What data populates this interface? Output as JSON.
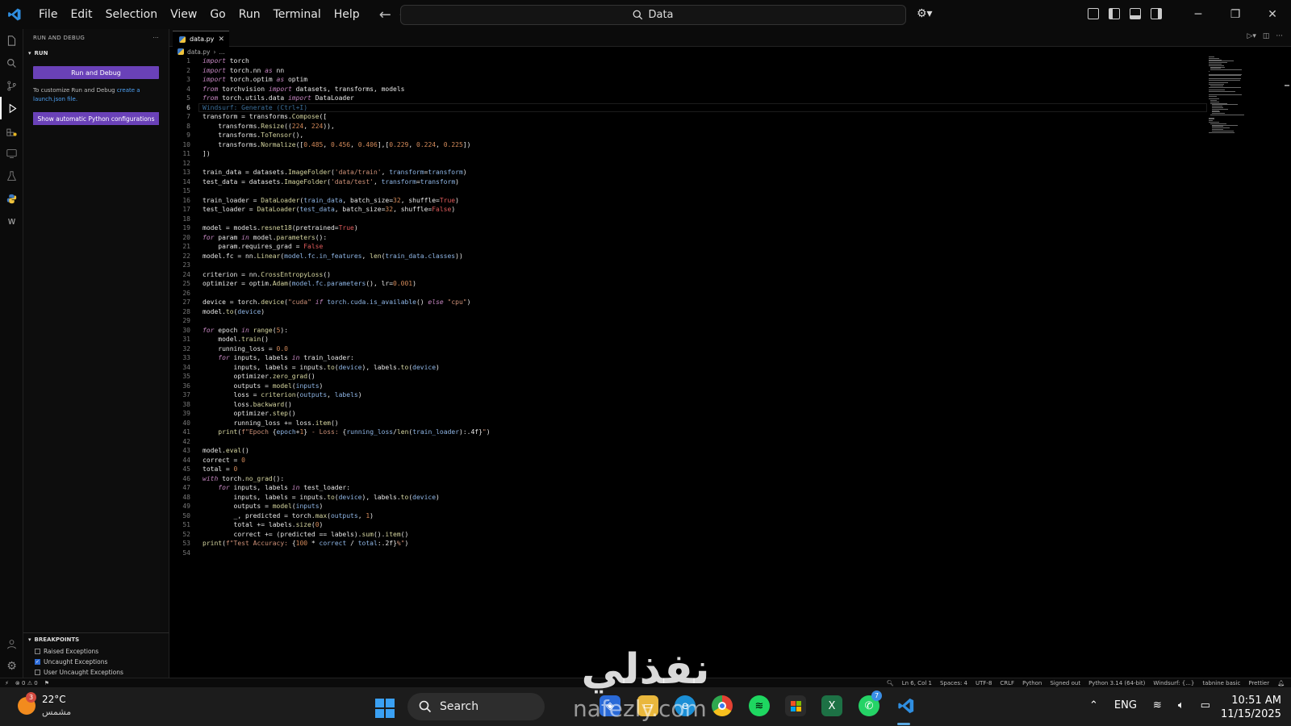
{
  "titlebar": {
    "menu": [
      "File",
      "Edit",
      "Selection",
      "View",
      "Go",
      "Run",
      "Terminal",
      "Help"
    ],
    "search_text": "Data"
  },
  "sidebar": {
    "title": "RUN AND DEBUG",
    "section": "RUN",
    "run_button": "Run and Debug",
    "customize_text": "To customize Run and Debug",
    "customize_link": "create a launch.json file.",
    "show_config_button": "Show automatic Python configurations",
    "breakpoints_title": "BREAKPOINTS",
    "breakpoints": [
      {
        "label": "Raised Exceptions",
        "checked": false
      },
      {
        "label": "Uncaught Exceptions",
        "checked": true
      },
      {
        "label": "User Uncaught Exceptions",
        "checked": false
      }
    ]
  },
  "editor": {
    "tab_name": "data.py",
    "breadcrumb_file": "data.py",
    "breadcrumb_rest": "...",
    "current_line": 6,
    "lines": [
      "<span class='kw'>import</span> torch",
      "<span class='kw'>import</span> torch.nn <span class='kw'>as</span> nn",
      "<span class='kw'>import</span> torch.optim <span class='kw'>as</span> optim",
      "<span class='kw'>from</span> torchvision <span class='kw'>import</span> datasets, transforms, models",
      "<span class='kw'>from</span> torch.utils.data <span class='kw'>import</span> DataLoader",
      "<span class='hint'>Windsurf: Generate (Ctrl+I)</span>",
      "transform = transforms.<span class='fn'>Compose</span>([",
      "    transforms.<span class='fn'>Resize</span>((<span class='num'>224</span>, <span class='num'>224</span>)),",
      "    transforms.<span class='fn'>ToTensor</span>(),",
      "    transforms.<span class='fn'>Normalize</span>([<span class='num'>0.485</span>, <span class='num'>0.456</span>, <span class='num'>0.406</span>],[<span class='num'>0.229</span>, <span class='num'>0.224</span>, <span class='num'>0.225</span>])",
      "])",
      "",
      "train_data = datasets.<span class='fn'>ImageFolder</span>(<span class='str'>'data/train'</span>, <span class='var'>transform</span>=<span class='var'>transform</span>)",
      "test_data = datasets.<span class='fn'>ImageFolder</span>(<span class='str'>'data/test'</span>, <span class='var'>transform</span>=<span class='var'>transform</span>)",
      "",
      "train_loader = <span class='fn'>DataLoader</span>(<span class='var'>train_data</span>, batch_size=<span class='num'>32</span>, shuffle=<span class='bool'>True</span>)",
      "test_loader = <span class='fn'>DataLoader</span>(<span class='var'>test_data</span>, batch_size=<span class='num'>32</span>, shuffle=<span class='bool'>False</span>)",
      "",
      "model = models.<span class='fn'>resnet18</span>(pretrained=<span class='bool'>True</span>)",
      "<span class='kw'>for</span> param <span class='kw'>in</span> model.<span class='fn'>parameters</span>():",
      "    param.requires_grad = <span class='bool'>False</span>",
      "model.fc = nn.<span class='fn'>Linear</span>(<span class='var'>model.fc.in_features</span>, <span class='fn'>len</span>(<span class='var'>train_data.classes</span>))",
      "",
      "criterion = nn.<span class='fn'>CrossEntropyLoss</span>()",
      "optimizer = optim.<span class='fn'>Adam</span>(<span class='var'>model.fc.parameters</span>(), lr=<span class='num'>0.001</span>)",
      "",
      "device = torch.<span class='fn'>device</span>(<span class='str'>\"cuda\"</span> <span class='kw'>if</span> <span class='var'>torch.cuda.is_available</span>() <span class='kw'>else</span> <span class='str'>\"cpu\"</span>)",
      "model.<span class='fn'>to</span>(<span class='var'>device</span>)",
      "",
      "<span class='kw'>for</span> epoch <span class='kw'>in</span> <span class='fn'>range</span>(<span class='num'>5</span>):",
      "    model.<span class='fn'>train</span>()",
      "    running_loss = <span class='num'>0.0</span>",
      "    <span class='kw'>for</span> inputs, labels <span class='kw'>in</span> train_loader:",
      "        inputs, labels = inputs.<span class='fn'>to</span>(<span class='var'>device</span>), labels.<span class='fn'>to</span>(<span class='var'>device</span>)",
      "        optimizer.<span class='fn'>zero_grad</span>()",
      "        outputs = <span class='fn'>model</span>(<span class='var'>inputs</span>)",
      "        loss = <span class='fn'>criterion</span>(<span class='var'>outputs</span>, <span class='var'>labels</span>)",
      "        loss.<span class='fn'>backward</span>()",
      "        optimizer.<span class='fn'>step</span>()",
      "        running_loss += loss.<span class='fn'>item</span>()",
      "    <span class='fn'>print</span>(<span class='str'>f\"Epoch </span>{<span class='var'>epoch</span>+<span class='num'>1</span>}<span class='str'> - Loss: </span>{<span class='var'>running_loss</span>/<span class='fn'>len</span>(<span class='var'>train_loader</span>):.4f}<span class='str'>\"</span>)",
      "",
      "model.<span class='fn'>eval</span>()",
      "correct = <span class='num'>0</span>",
      "total = <span class='num'>0</span>",
      "<span class='kw'>with</span> torch.<span class='fn'>no_grad</span>():",
      "    <span class='kw'>for</span> inputs, labels <span class='kw'>in</span> test_loader:",
      "        inputs, labels = inputs.<span class='fn'>to</span>(<span class='var'>device</span>), labels.<span class='fn'>to</span>(<span class='var'>device</span>)",
      "        outputs = <span class='fn'>model</span>(<span class='var'>inputs</span>)",
      "        _, predicted = torch.<span class='fn'>max</span>(<span class='var'>outputs</span>, <span class='num'>1</span>)",
      "        total += labels.<span class='fn'>size</span>(<span class='num'>0</span>)",
      "        correct += (predicted == labels).<span class='fn'>sum</span>().<span class='fn'>item</span>()",
      "<span class='fn'>print</span>(<span class='str'>f\"Test Accuracy: </span>{<span class='num'>100</span> * <span class='var'>correct</span> / <span class='var'>total</span>:.2f}<span class='str'>%\"</span>)",
      ""
    ]
  },
  "statusbar": {
    "errors": "0",
    "warnings": "0",
    "position": "Ln 6, Col 1",
    "spaces": "Spaces: 4",
    "encoding": "UTF-8",
    "eol": "CRLF",
    "language": "Python",
    "account": "Signed out",
    "interpreter": "Python 3.14 (64-bit)",
    "windsurf": "Windsurf: {...}",
    "tabnine": "tabnine basic",
    "prettier": "Prettier"
  },
  "taskbar": {
    "temperature": "22°C",
    "weather_desc": "مشمس",
    "weather_badge": "3",
    "search_label": "Search",
    "language": "ENG",
    "time": "10:51 AM",
    "date": "11/15/2025",
    "whatsapp_badge": "7"
  },
  "watermark": {
    "arabic": "نفذلي",
    "latin": "nafezly.com"
  },
  "colors": {
    "accent_button": "#6a41b8",
    "link": "#4ea1f3",
    "windows_blue": "#3aa0f3"
  }
}
